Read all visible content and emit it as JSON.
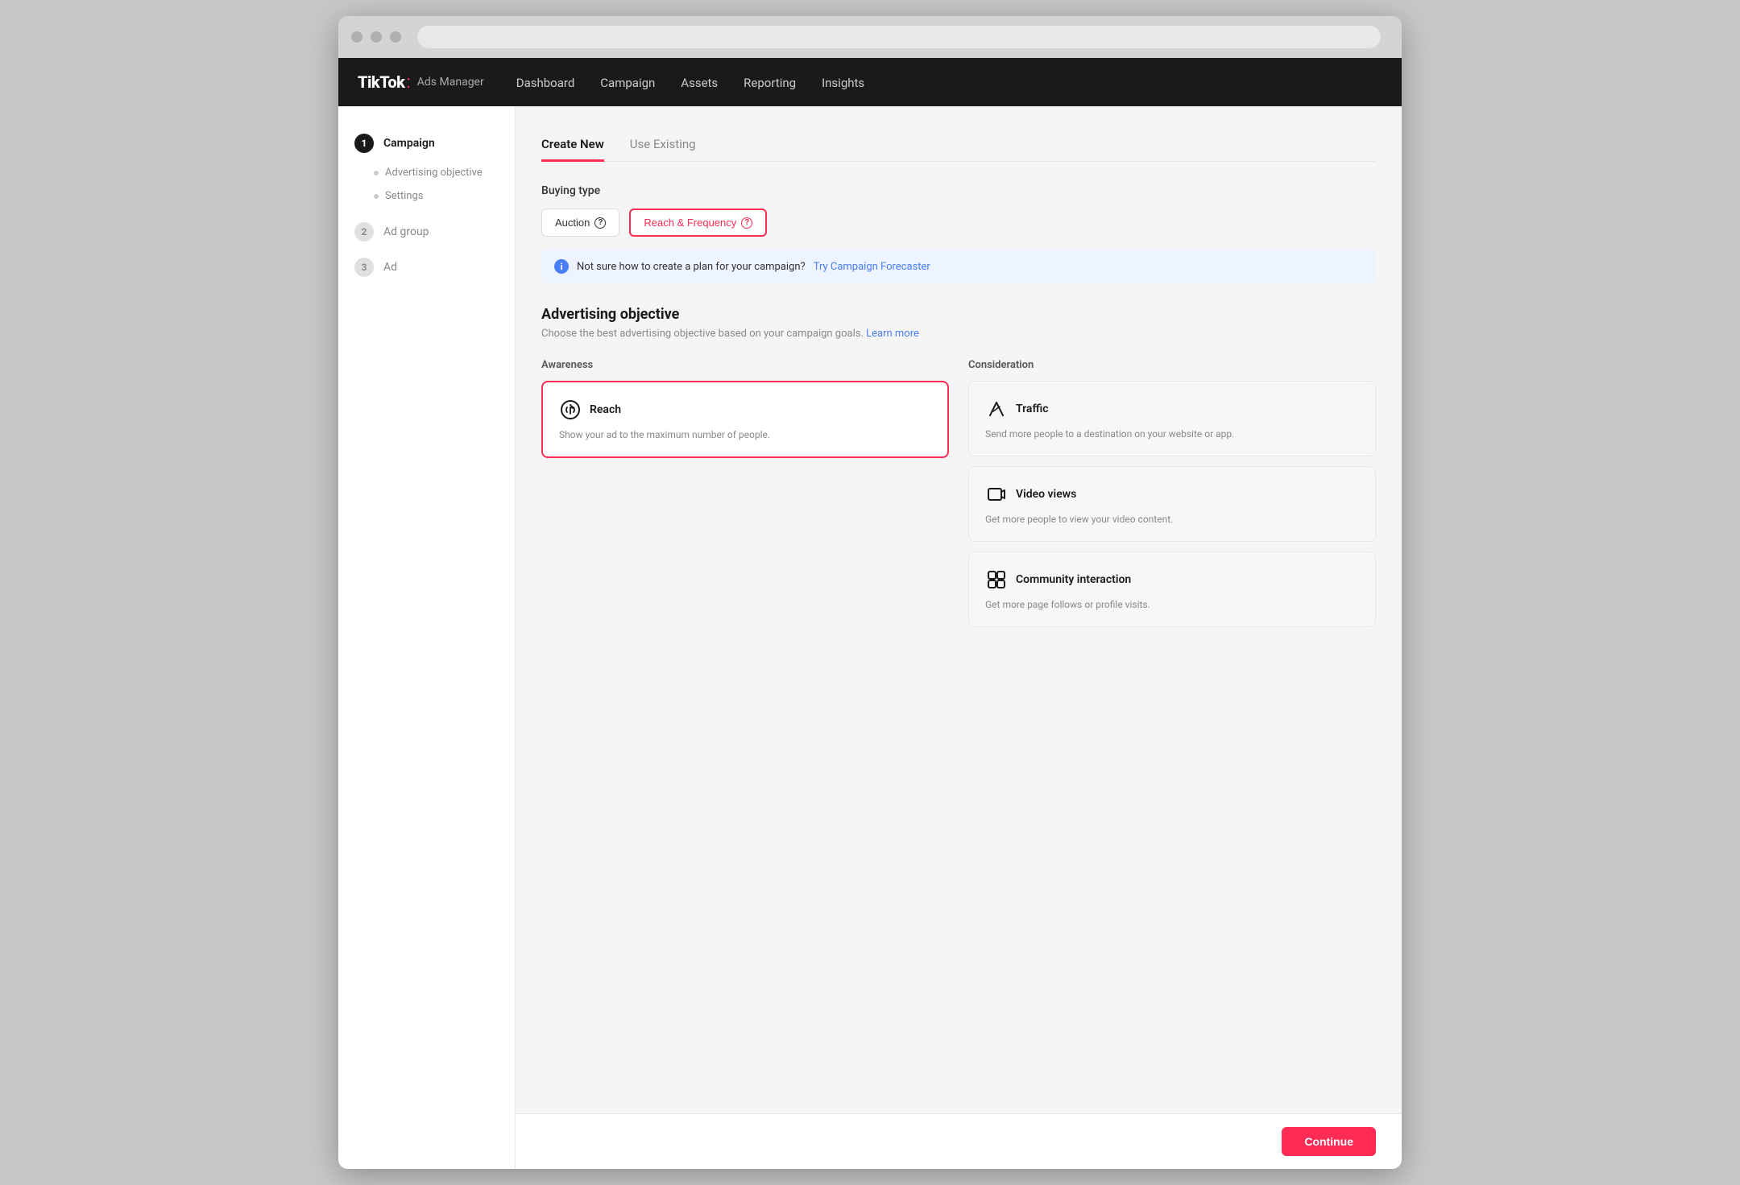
{
  "browser": {
    "dots": [
      "dot1",
      "dot2",
      "dot3"
    ]
  },
  "nav": {
    "logo_tiktok": "TikTok",
    "logo_dot": ":",
    "logo_adsmanager": "Ads Manager",
    "links": [
      {
        "id": "dashboard",
        "label": "Dashboard"
      },
      {
        "id": "campaign",
        "label": "Campaign"
      },
      {
        "id": "assets",
        "label": "Assets"
      },
      {
        "id": "reporting",
        "label": "Reporting"
      },
      {
        "id": "insights",
        "label": "Insights"
      }
    ]
  },
  "sidebar": {
    "items": [
      {
        "step": "1",
        "label": "Campaign",
        "active": true
      },
      {
        "step": null,
        "label": "Advertising objective",
        "sub": true
      },
      {
        "step": null,
        "label": "Settings",
        "sub": true
      },
      {
        "step": "2",
        "label": "Ad group",
        "active": false
      },
      {
        "step": "3",
        "label": "Ad",
        "active": false
      }
    ]
  },
  "tabs": {
    "create_new": "Create New",
    "use_existing": "Use Existing"
  },
  "buying_type": {
    "label": "Buying type",
    "auction": "Auction",
    "reach_frequency": "Reach & Frequency",
    "info_icon": "?"
  },
  "info_banner": {
    "text": "Not sure how to create a plan for your campaign?",
    "link": "Try Campaign Forecaster"
  },
  "advertising_objective": {
    "title": "Advertising objective",
    "description": "Choose the best advertising objective based on your campaign goals.",
    "learn_more": "Learn more",
    "awareness_label": "Awareness",
    "consideration_label": "Consideration",
    "awareness_cards": [
      {
        "id": "reach",
        "title": "Reach",
        "description": "Show your ad to the maximum number of people.",
        "selected": true
      }
    ],
    "consideration_cards": [
      {
        "id": "traffic",
        "title": "Traffic",
        "description": "Send more people to a destination on your website or app.",
        "selected": false
      },
      {
        "id": "video_views",
        "title": "Video views",
        "description": "Get more people to view your video content.",
        "selected": false
      },
      {
        "id": "community_interaction",
        "title": "Community interaction",
        "description": "Get more page follows or profile visits.",
        "selected": false
      }
    ]
  },
  "footer": {
    "continue_label": "Continue"
  }
}
